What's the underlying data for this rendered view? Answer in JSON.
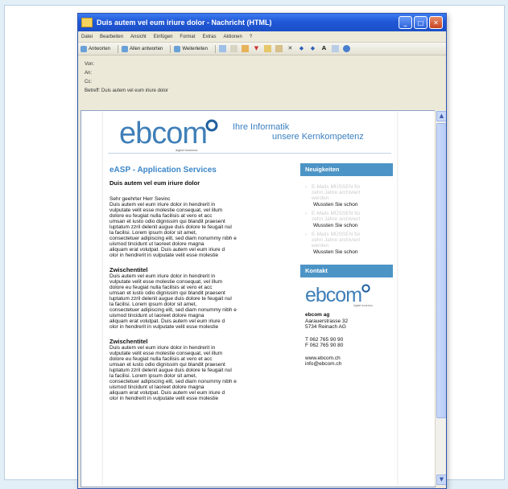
{
  "window": {
    "title": "Duis autem vel eum iriure dolor - Nachricht (HTML)",
    "controls": [
      "_",
      "□",
      "✕"
    ]
  },
  "menu": [
    "Datei",
    "Bearbeiten",
    "Ansicht",
    "Einfügen",
    "Format",
    "Extras",
    "Aktionen",
    "?"
  ],
  "toolbar": {
    "reply": "Antworten",
    "reply_all": "Allen antworten",
    "forward": "Weiterleiten"
  },
  "header": {
    "from_label": "Von:",
    "to_label": "An:",
    "cc_label": "Cc:",
    "subject_label": "Betreff:",
    "subject_value": "Duis autem vel eum iriure dolor"
  },
  "email": {
    "logo_text": "ebcom",
    "logo_sub": "digital business",
    "tagline1": "Ihre Informatik",
    "tagline2": "unsere Kernkompetenz",
    "section_title": "eASP - Application Services",
    "subtitle": "Duis autem vel eum iriure dolor",
    "greeting": "Sehr geehrter Herr Sevinc",
    "para1": "Duis autem vel eum iriure dolor in hendrerit in\nvulputate velit esse molestie consequat, vel illum\ndolore eu feugiat nulla facilisis at vero et acc\numsan et iusto odio dignissim qui blandit praesent\nluptatum zzril delenit augue duis dolore te feugait nul\nla facilisi. Lorem ipsum dolor sit amet,\nconsectetuer adipiscing elit, sed diam nonummy nibh e\nuismod tincidunt ut laoreet dolore magna\naliquam erat volutpat. Duis autem vel eum iriure d\nolor in hendrerit in vulputate velit esse molestie",
    "sub1_title": "Zwischentitel",
    "sub1_body": "Duis autem vel eum iriure dolor in hendrerit in\nvulputate velit esse molestie consequat, vel illum\ndolore eu feugiat nulla facilisis at vero et acc\numsan et iusto odio dignissim qui blandit praesent\nluptatum zzril delenit augue duis dolore te feugait nul\nla facilisi. Lorem ipsum dolor sit amet,\nconsectetuer adipiscing elit, sed diam nonummy nibh e\nuismod tincidunt ut laoreet dolore magna\naliquam erat volutpat. Duis autem vel eum iriure d\nolor in hendrerit in vulputate velit esse molestie",
    "sub2_title": "Zwischentitel",
    "sub2_body": "Duis autem vel eum iriure dolor in hendrerit in\nvulputate velit esse molestie consequat, vel illum\ndolore eu feugiat nulla facilisis at vero et acc\numsan et iusto odio dignissim qui blandit praesent\nluptatum zzril delenit augue duis dolore te feugait nul\nla facilisi. Lorem ipsum dolor sit amet,\nconsectetuer adipiscing elit, sed diam nonummy nibh e\nuismod tincidunt ut laoreet dolore magna\naliquam erat volutpat. Duis autem vel eum iriure d\nolor in hendrerit in vulputate velit esse molestie"
  },
  "sidebar": {
    "news_title": "Neuigkeiten",
    "news": [
      {
        "ghost": [
          "E-Mails MÜSSEN für",
          "zehn Jahre archiviert",
          "werden"
        ],
        "link": "Wussten Sie schon"
      },
      {
        "ghost": [
          "E-Mails MÜSSEN für",
          "zehn Jahre archiviert"
        ],
        "link": "Wussten Sie schon"
      },
      {
        "ghost": [
          "E-Mails MÜSSEN für",
          "zehn Jahre archiviert",
          "werden"
        ],
        "link": "Wussten Sie schon"
      }
    ],
    "contact_title": "Kontakt",
    "contact_logo": "ebcom",
    "contact_logo_sub": "digital business",
    "company": "ebcom ag",
    "street": "Aarauerstrasse 32",
    "city": "5734 Reinach AG",
    "phone": "T 062 765 90 90",
    "fax": "F 062 765 90 80",
    "web": "www.ebcom.ch",
    "email": "info@ebcom.ch"
  },
  "colors": {
    "accent": "#4d94c6",
    "titlebar": "#2158d6",
    "heading": "#3b86c8"
  }
}
